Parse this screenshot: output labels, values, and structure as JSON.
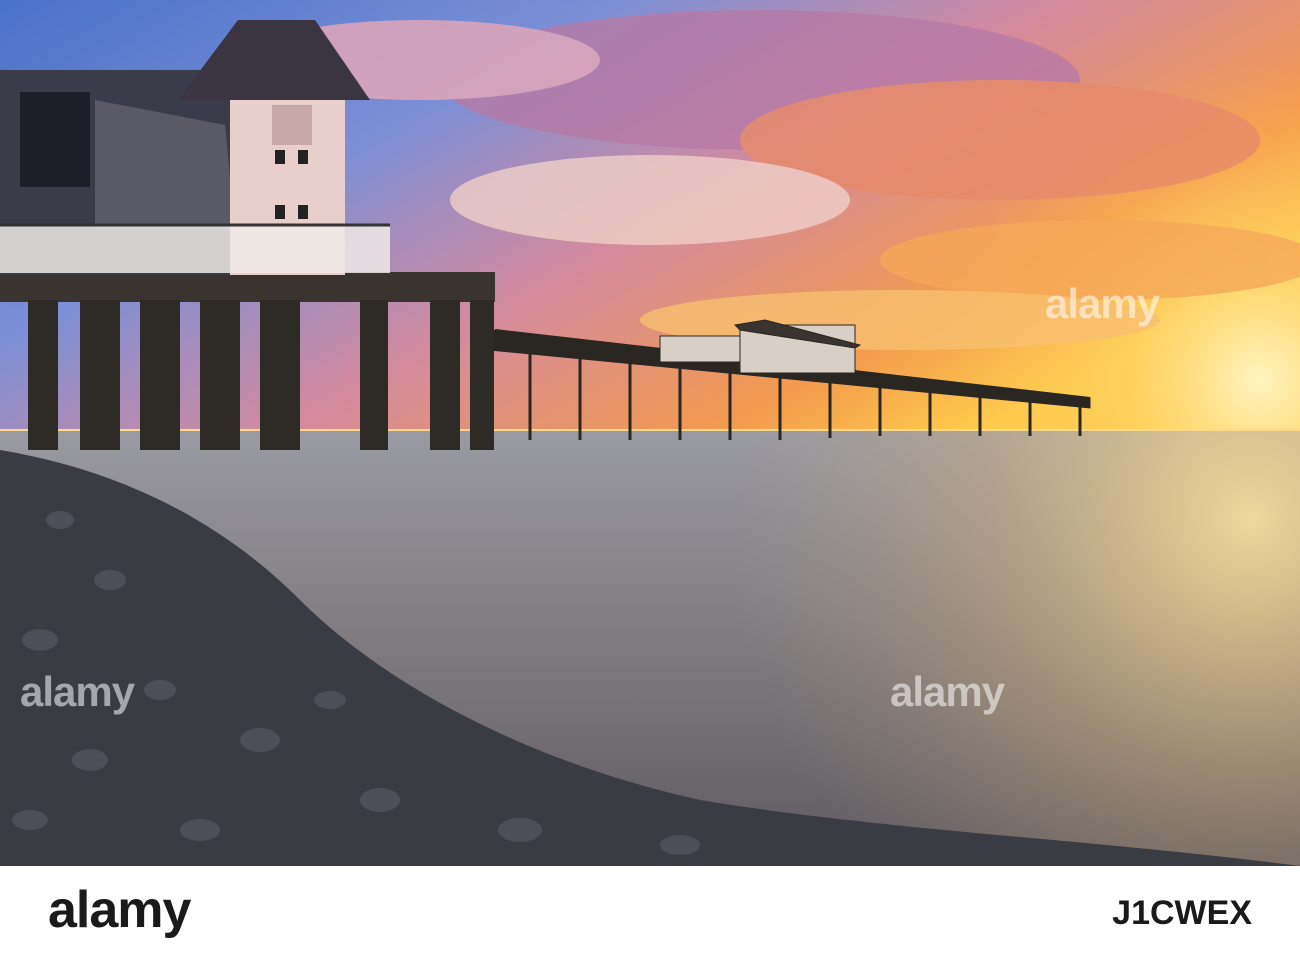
{
  "photo": {
    "subject": "pier",
    "colors": {
      "sky_warm": "#f5a64a",
      "sky_blue": "#5b8fd6",
      "sea": "#8a8e96",
      "pebbles": "#3a3c44",
      "structure": "#2a2622"
    }
  },
  "watermark": {
    "text": "alamy"
  },
  "footer": {
    "logo_text": "alamy",
    "image_code": "J1CWEX"
  }
}
